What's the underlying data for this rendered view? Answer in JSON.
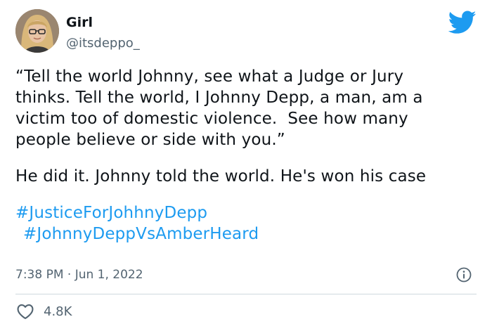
{
  "author": {
    "display_name": "Girl",
    "handle": "@itsdeppo_"
  },
  "tweet": {
    "lines": [
      "“Tell the world Johnny, see what a Judge or Jury",
      "thinks. Tell the world, I Johnny Depp, a man, am a",
      "victim too of domestic violence.  See how many",
      "people believe or side with you.”",
      "He did it. Johnny told the world. He's won his case"
    ],
    "hashtags": [
      "#JusticeForJohhnyDepp",
      "#JohnnyDeppVsAmberHeard"
    ]
  },
  "meta": {
    "timestamp": "7:38 PM · Jun 1, 2022"
  },
  "engagement": {
    "likes": "4.8K"
  },
  "icons": {
    "brand": "twitter-bird-icon",
    "info": "info-icon",
    "like": "heart-icon"
  },
  "colors": {
    "brand_blue": "#1d9bf0",
    "text": "#0f1419",
    "secondary": "#536471"
  }
}
